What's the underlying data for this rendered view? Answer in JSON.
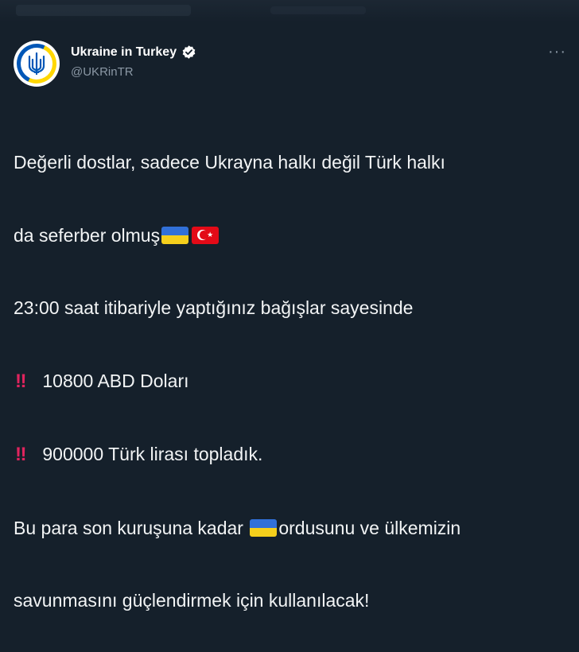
{
  "account": {
    "display_name": "Ukraine in Turkey",
    "handle": "@UKRinTR",
    "verified": true,
    "avatar_icon": "ukraine-trident-icon"
  },
  "menu": {
    "more_label": "···"
  },
  "tweet": {
    "line1": "Değerli dostlar, sadece Ukrayna halkı değil Türk halkı",
    "line2": "da seferber olmuş",
    "line3": "23:00 saat itibariyle yaptığınız bağışlar sayesinde",
    "line4": "10800 ABD Doları",
    "line5": "900000 Türk lirası topladık.",
    "line6a": "Bu para son kuruşuna kadar ",
    "line6b": "ordusunu ve ülkemizin",
    "line7": "savunmasını güçlendirmek için kullanılacak!",
    "emoji_bang": "‼"
  },
  "colors": {
    "background": "#15202b",
    "text": "#f2f4f5",
    "secondary": "#8b98a5",
    "verified": "#ffffff",
    "bang": "#e0245e"
  }
}
